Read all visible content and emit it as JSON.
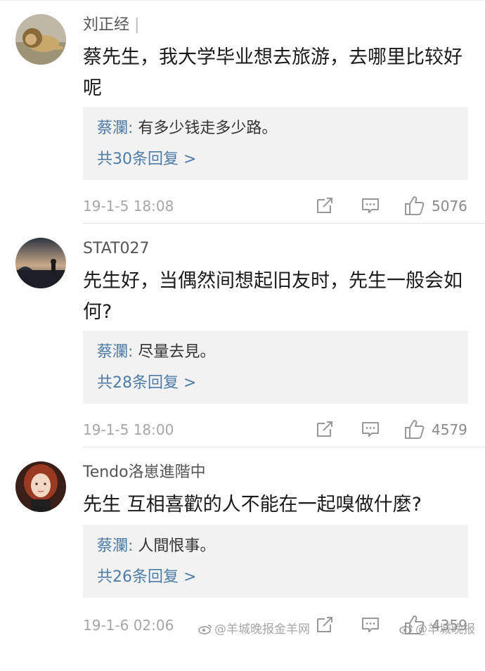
{
  "comments": [
    {
      "user": "刘正经",
      "text": "蔡先生，我大学毕业想去旅游，去哪里比较好呢",
      "reply": {
        "author": "蔡瀾",
        "sep": ": ",
        "content": "有多少钱走多少路。",
        "count_label": "共30条回复 >"
      },
      "timestamp": "19-1-5 18:08",
      "likes": "5076",
      "avatar_icon": "lion-avatar"
    },
    {
      "user": "STAT027",
      "text": "先生好，当偶然间想起旧友时，先生一般会如何?",
      "reply": {
        "author": "蔡瀾",
        "sep": ": ",
        "content": "尽量去見。",
        "count_label": "共28条回复 >"
      },
      "timestamp": "19-1-5 18:00",
      "likes": "4579",
      "avatar_icon": "sunset-avatar"
    },
    {
      "user": "Tendo洛崽進階中",
      "text": "先生 互相喜歡的人不能在一起嗅做什麼?",
      "reply": {
        "author": "蔡瀾",
        "sep": ": ",
        "content": "人間恨事。",
        "count_label": "共26条回复 >"
      },
      "timestamp": "19-1-6 02:06",
      "likes": "4359",
      "avatar_icon": "portrait-avatar"
    }
  ],
  "watermarks": {
    "left": "@羊城晚报金羊网",
    "right": "@羊城晚报"
  },
  "colors": {
    "link_blue": "#4d7ca8",
    "reply_bg": "#f2f2f2",
    "meta_gray": "#a6a6a6"
  }
}
